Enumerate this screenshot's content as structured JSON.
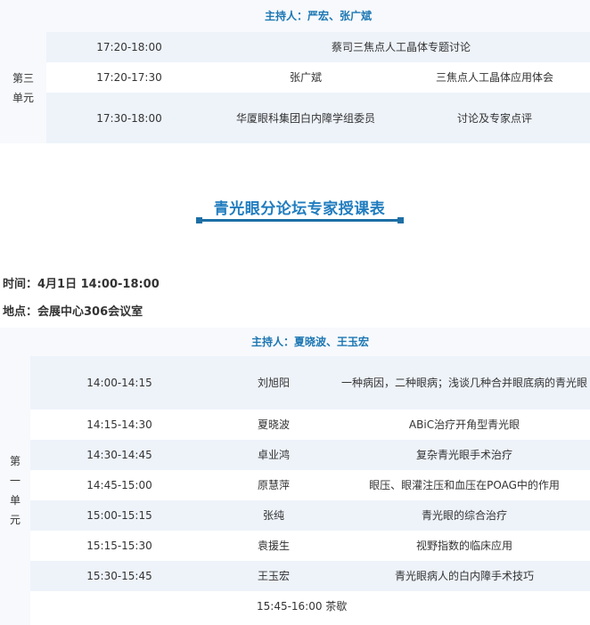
{
  "section3": {
    "host": "主持人：严宏、张广斌",
    "unit_label": "第三\n单元",
    "rows": [
      {
        "time": "17:20-18:00",
        "speaker": "",
        "topic": "蔡司三焦点人工晶体专题讨论"
      },
      {
        "time": "17:20-17:30",
        "speaker": "张广斌",
        "topic": "三焦点人工晶体应用体会"
      },
      {
        "time": "17:30-18:00",
        "speaker": "华厦眼科集团白内障学组委员",
        "topic": "讨论及专家点评"
      }
    ]
  },
  "forum": {
    "title": "青光眼分论坛专家授课表",
    "time_line": "时间：4月1日 14:00-18:00",
    "place_line": "地点：会展中心306会议室"
  },
  "section1": {
    "host": "主持人：夏晓波、王玉宏",
    "unit_chars": [
      "第",
      "一",
      "单",
      "元"
    ],
    "rows": [
      {
        "time": "14:00-14:15",
        "speaker": "刘旭阳",
        "topic": "一种病因，二种眼病；浅谈几种合并眼底病的青光眼"
      },
      {
        "time": "14:15-14:30",
        "speaker": "夏晓波",
        "topic": "ABiC治疗开角型青光眼"
      },
      {
        "time": "14:30-14:45",
        "speaker": "卓业鸿",
        "topic": "复杂青光眼手术治疗"
      },
      {
        "time": "14:45-15:00",
        "speaker": "原慧萍",
        "topic": "眼压、眼灌注压和血压在POAG中的作用"
      },
      {
        "time": "15:00-15:15",
        "speaker": "张纯",
        "topic": "青光眼的综合治疗"
      },
      {
        "time": "15:15-15:30",
        "speaker": "袁援生",
        "topic": "视野指数的临床应用"
      },
      {
        "time": "15:30-15:45",
        "speaker": "王玉宏",
        "topic": "青光眼病人的白内障手术技巧"
      }
    ],
    "break_line": "15:45-16:00 茶歇"
  }
}
